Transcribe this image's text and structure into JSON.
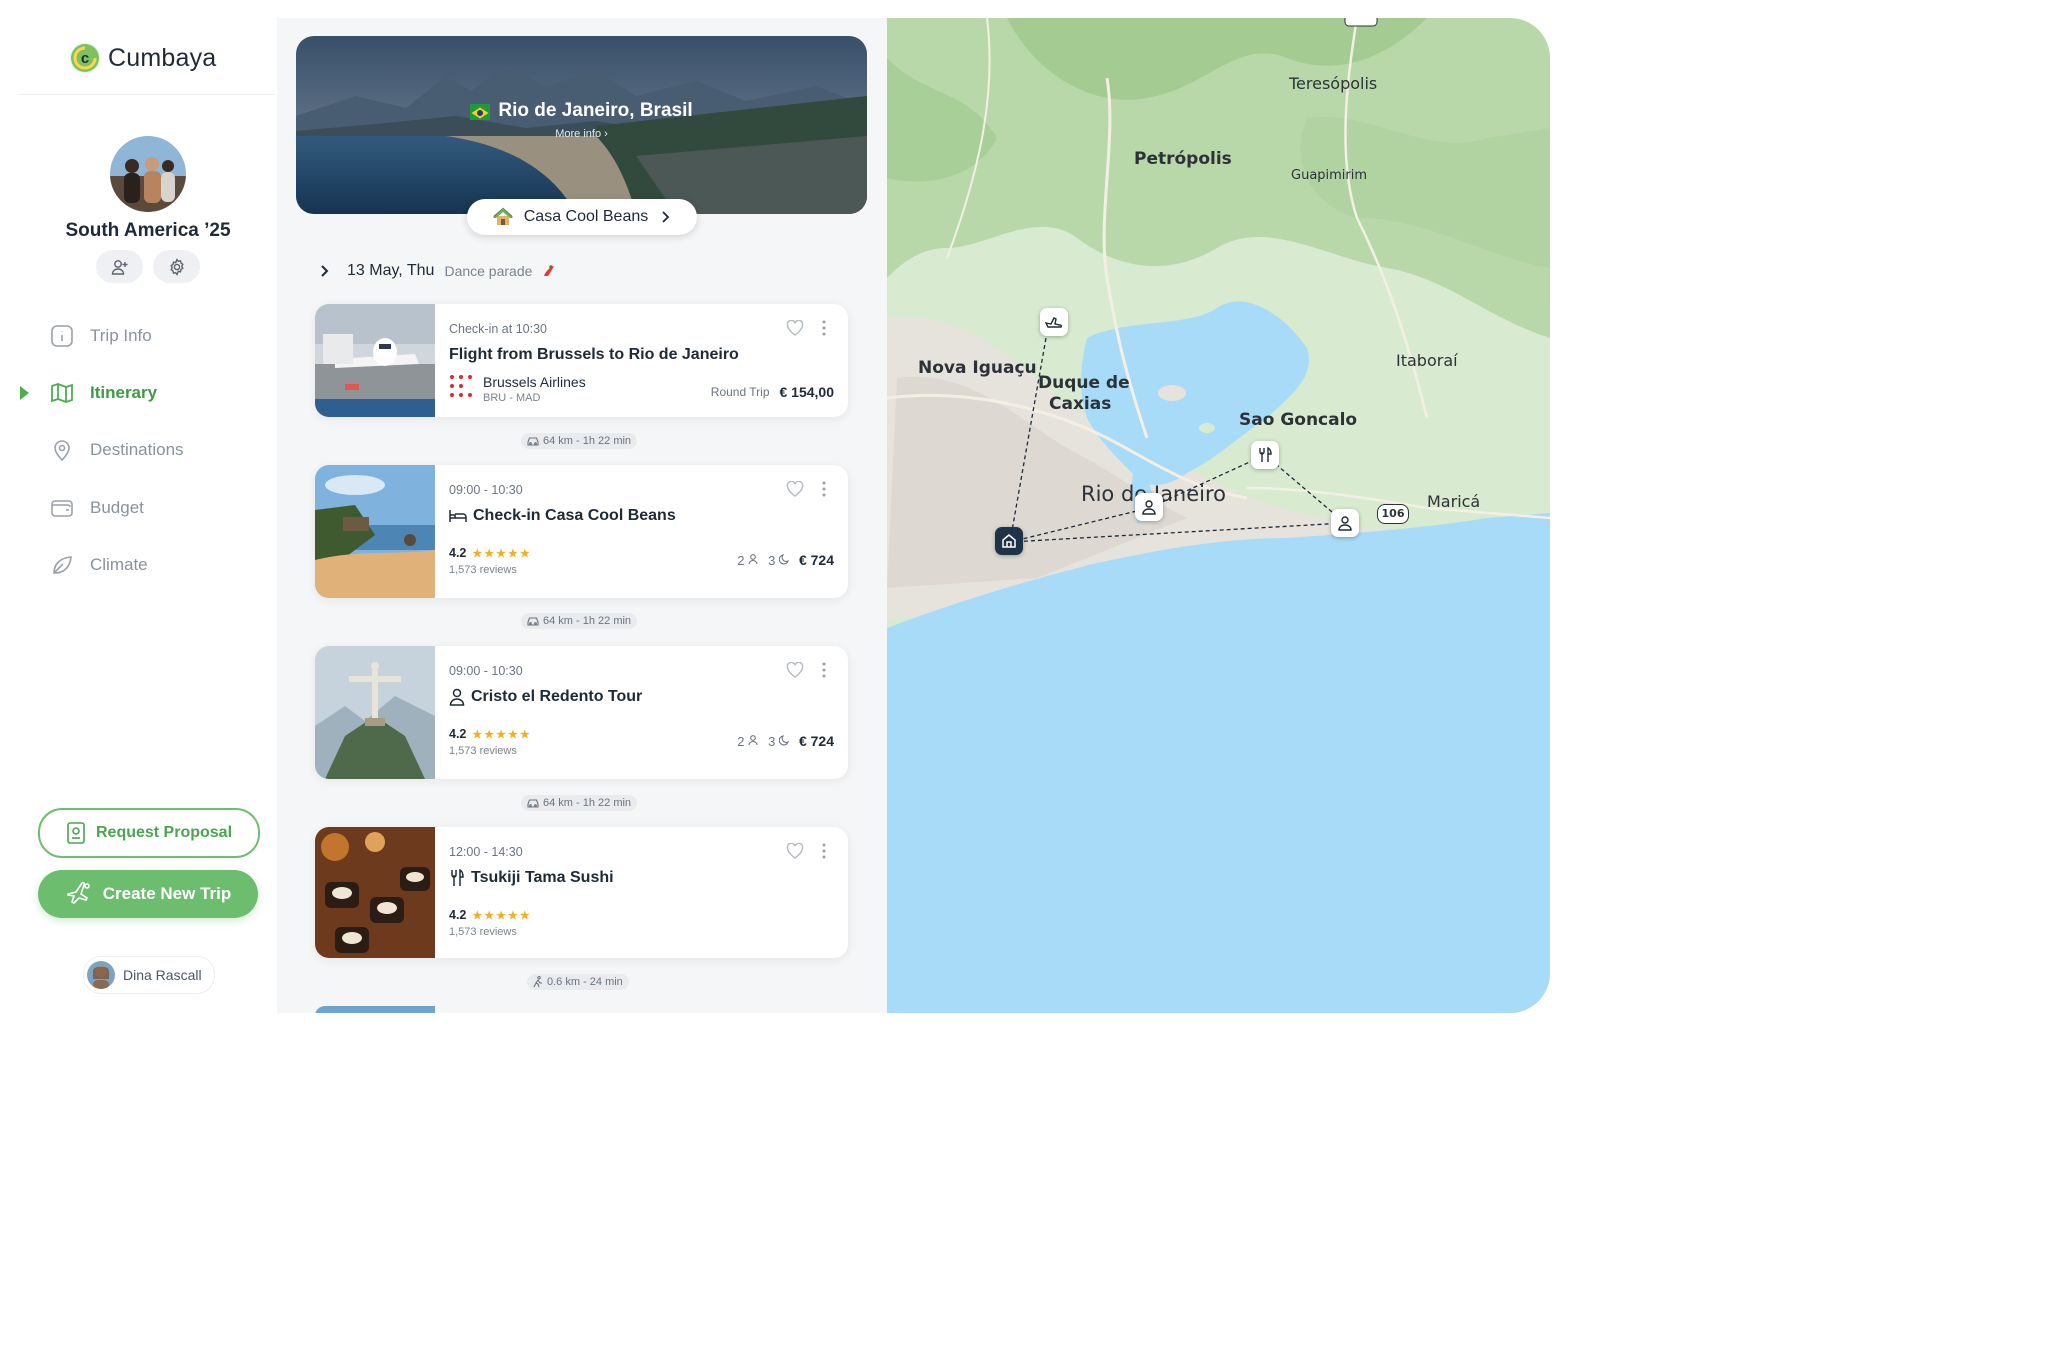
{
  "app": {
    "name": "Cumbaya"
  },
  "trip": {
    "title": "South America ’25"
  },
  "nav": {
    "items": [
      {
        "label": "Trip Info",
        "icon": "info-icon",
        "active": false
      },
      {
        "label": "Itinerary",
        "icon": "map-book-icon",
        "active": true
      },
      {
        "label": "Destinations",
        "icon": "map-pin-icon",
        "active": false
      },
      {
        "label": "Budget",
        "icon": "wallet-icon",
        "active": false
      },
      {
        "label": "Climate",
        "icon": "leaf-icon",
        "active": false
      }
    ]
  },
  "actions": {
    "request_proposal": "Request Proposal",
    "create_trip": "Create New Trip"
  },
  "user": {
    "name": "Dina Rascall"
  },
  "destination": {
    "title": "Rio de Janeiro, Brasil",
    "more_info": "More info ›",
    "hotel": "Casa Cool Beans"
  },
  "day": {
    "date": "13 May, Thu",
    "note": "Dance parade"
  },
  "cards": [
    {
      "time": "Check-in at 10:30",
      "title": "Flight from Brussels to Rio de Janeiro",
      "airline": "Brussels Airlines",
      "route": "BRU - MAD",
      "trip_type": "Round Trip",
      "price": "€ 154,00"
    },
    {
      "time": "09:00 - 10:30",
      "title": "Check-in Casa Cool Beans",
      "rating": "4.2",
      "reviews": "1,573 reviews",
      "guests": "2",
      "nights": "3",
      "price": "€ 724"
    },
    {
      "time": "09:00 - 10:30",
      "title": "Cristo el Redento Tour",
      "rating": "4.2",
      "reviews": "1,573 reviews",
      "guests": "2",
      "nights": "3",
      "price": "€ 724"
    },
    {
      "time": "12:00 - 14:30",
      "title": "Tsukiji Tama Sushi",
      "rating": "4.2",
      "reviews": "1,573 reviews"
    }
  ],
  "transfers": [
    "64 km - 1h 22 min",
    "64 km - 1h 22 min",
    "64 km - 1h 22 min",
    "0.6 km - 24 min"
  ],
  "map": {
    "places": [
      "Teresópolis",
      "Petrópolis",
      "Guapimirim",
      "Nova Iguaçu",
      "Duque de",
      "Caxias",
      "Itaboraí",
      "Sao Goncalo",
      "Rio de Janeiro",
      "Maricá",
      "106"
    ]
  },
  "colors": {
    "accent": "#4caf50",
    "water": "#a7dbf7",
    "land": "#d9ecd3"
  }
}
